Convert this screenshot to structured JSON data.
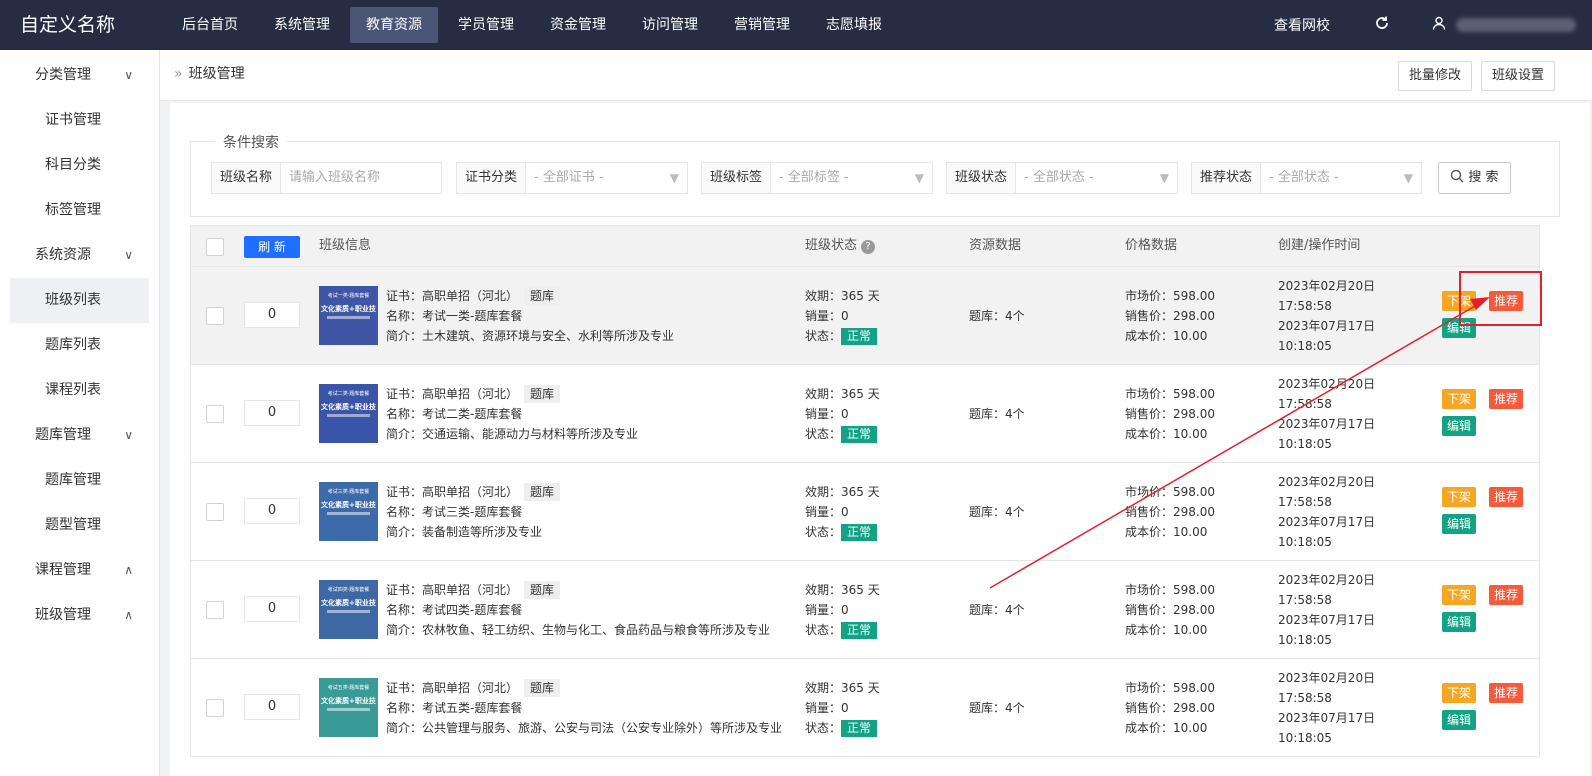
{
  "topbar": {
    "logo": "自定义名称",
    "nav": [
      "后台首页",
      "系统管理",
      "教育资源",
      "学员管理",
      "资金管理",
      "访问管理",
      "营销管理",
      "志愿填报"
    ],
    "active_nav": "教育资源",
    "view_school": "查看网校",
    "refresh_icon": "refresh-icon",
    "user_icon": "user-icon"
  },
  "sidebar": {
    "groups": [
      {
        "label": "分类管理",
        "expanded": true
      },
      {
        "label": "证书管理"
      },
      {
        "label": "科目分类"
      },
      {
        "label": "标签管理"
      },
      {
        "label": "系统资源",
        "expanded": true
      },
      {
        "label": "班级列表",
        "active": true
      },
      {
        "label": "题库列表"
      },
      {
        "label": "课程列表"
      },
      {
        "label": "题库管理",
        "expanded": true
      },
      {
        "label": "题库管理"
      },
      {
        "label": "题型管理"
      },
      {
        "label": "课程管理",
        "expanded": false
      },
      {
        "label": "班级管理",
        "expanded": false
      }
    ]
  },
  "header": {
    "breadcrumb": "班级管理",
    "batch_edit": "批量修改",
    "class_settings": "班级设置"
  },
  "search": {
    "legend": "条件搜索",
    "class_name_label": "班级名称",
    "class_name_placeholder": "请输入班级名称",
    "cert_label": "证书分类",
    "cert_value": "- 全部证书 -",
    "tag_label": "班级标签",
    "tag_value": "- 全部标签 -",
    "status_label": "班级状态",
    "status_value": "- 全部状态 -",
    "recommend_label": "推荐状态",
    "recommend_value": "- 全部状态 -",
    "search_button": "搜 索"
  },
  "table": {
    "refresh": "刷 新",
    "headers": {
      "info": "班级信息",
      "status": "班级状态",
      "resource": "资源数据",
      "price": "价格数据",
      "time": "创建/操作时间"
    },
    "help_icon": "question-icon",
    "rows": [
      {
        "sort": "0",
        "cert": "证书：高职单招（河北）",
        "tag": "题库",
        "name": "名称：考试一类-题库套餐",
        "intro": "简介：土木建筑、资源环境与安全、水利等所涉及专业",
        "validity": "效期：365 天",
        "sales": "销量：0",
        "status_label": "状态：",
        "status": "正常",
        "resource": "题库：4个",
        "market": "市场价：598.00",
        "sale": "销售价：298.00",
        "cost": "成本价：10.00",
        "created_date": "2023年02月20日",
        "created_time": "17:58:58",
        "updated_date": "2023年07月17日",
        "updated_time": "10:18:05",
        "btn_down": "下架",
        "btn_rec": "推荐",
        "btn_edit": "编辑",
        "thumb_color": "#3f56a6",
        "thumb_top": "考试一类·题库套餐",
        "thumb_title": "文化素质+职业技能"
      },
      {
        "sort": "0",
        "cert": "证书：高职单招（河北）",
        "tag": "题库",
        "name": "名称：考试二类-题库套餐",
        "intro": "简介：交通运输、能源动力与材料等所涉及专业",
        "validity": "效期：365 天",
        "sales": "销量：0",
        "status_label": "状态：",
        "status": "正常",
        "resource": "题库：4个",
        "market": "市场价：598.00",
        "sale": "销售价：298.00",
        "cost": "成本价：10.00",
        "created_date": "2023年02月20日",
        "created_time": "17:58:58",
        "updated_date": "2023年07月17日",
        "updated_time": "10:18:05",
        "btn_down": "下架",
        "btn_rec": "推荐",
        "btn_edit": "编辑",
        "thumb_color": "#3a55a8",
        "thumb_top": "考试二类·题库套餐",
        "thumb_title": "文化素质+职业技能"
      },
      {
        "sort": "0",
        "cert": "证书：高职单招（河北）",
        "tag": "题库",
        "name": "名称：考试三类-题库套餐",
        "intro": "简介：装备制造等所涉及专业",
        "validity": "效期：365 天",
        "sales": "销量：0",
        "status_label": "状态：",
        "status": "正常",
        "resource": "题库：4个",
        "market": "市场价：598.00",
        "sale": "销售价：298.00",
        "cost": "成本价：10.00",
        "created_date": "2023年02月20日",
        "created_time": "17:58:58",
        "updated_date": "2023年07月17日",
        "updated_time": "10:18:05",
        "btn_down": "下架",
        "btn_rec": "推荐",
        "btn_edit": "编辑",
        "thumb_color": "#3d6aa8",
        "thumb_top": "考试三类·题库套餐",
        "thumb_title": "文化素质+职业技能"
      },
      {
        "sort": "0",
        "cert": "证书：高职单招（河北）",
        "tag": "题库",
        "name": "名称：考试四类-题库套餐",
        "intro": "简介：农林牧鱼、轻工纺织、生物与化工、食品药品与粮食等所涉及专业",
        "validity": "效期：365 天",
        "sales": "销量：0",
        "status_label": "状态：",
        "status": "正常",
        "resource": "题库：4个",
        "market": "市场价：598.00",
        "sale": "销售价：298.00",
        "cost": "成本价：10.00",
        "created_date": "2023年02月20日",
        "created_time": "17:58:58",
        "updated_date": "2023年07月17日",
        "updated_time": "10:18:05",
        "btn_down": "下架",
        "btn_rec": "推荐",
        "btn_edit": "编辑",
        "thumb_color": "#3d68a3",
        "thumb_top": "考试四类·题库套餐",
        "thumb_title": "文化素质+职业技能"
      },
      {
        "sort": "0",
        "cert": "证书：高职单招（河北）",
        "tag": "题库",
        "name": "名称：考试五类-题库套餐",
        "intro": "简介：公共管理与服务、旅游、公安与司法（公安专业除外）等所涉及专业",
        "validity": "效期：365 天",
        "sales": "销量：0",
        "status_label": "状态：",
        "status": "正常",
        "resource": "题库：4个",
        "market": "市场价：598.00",
        "sale": "销售价：298.00",
        "cost": "成本价：10.00",
        "created_date": "2023年02月20日",
        "created_time": "17:58:58",
        "updated_date": "2023年07月17日",
        "updated_time": "10:18:05",
        "btn_down": "下架",
        "btn_rec": "推荐",
        "btn_edit": "编辑",
        "thumb_color": "#3a9a98",
        "thumb_top": "考试五类·题库套餐",
        "thumb_title": "文化素质+职业技能"
      }
    ]
  },
  "annotation_color": "#e3202c"
}
